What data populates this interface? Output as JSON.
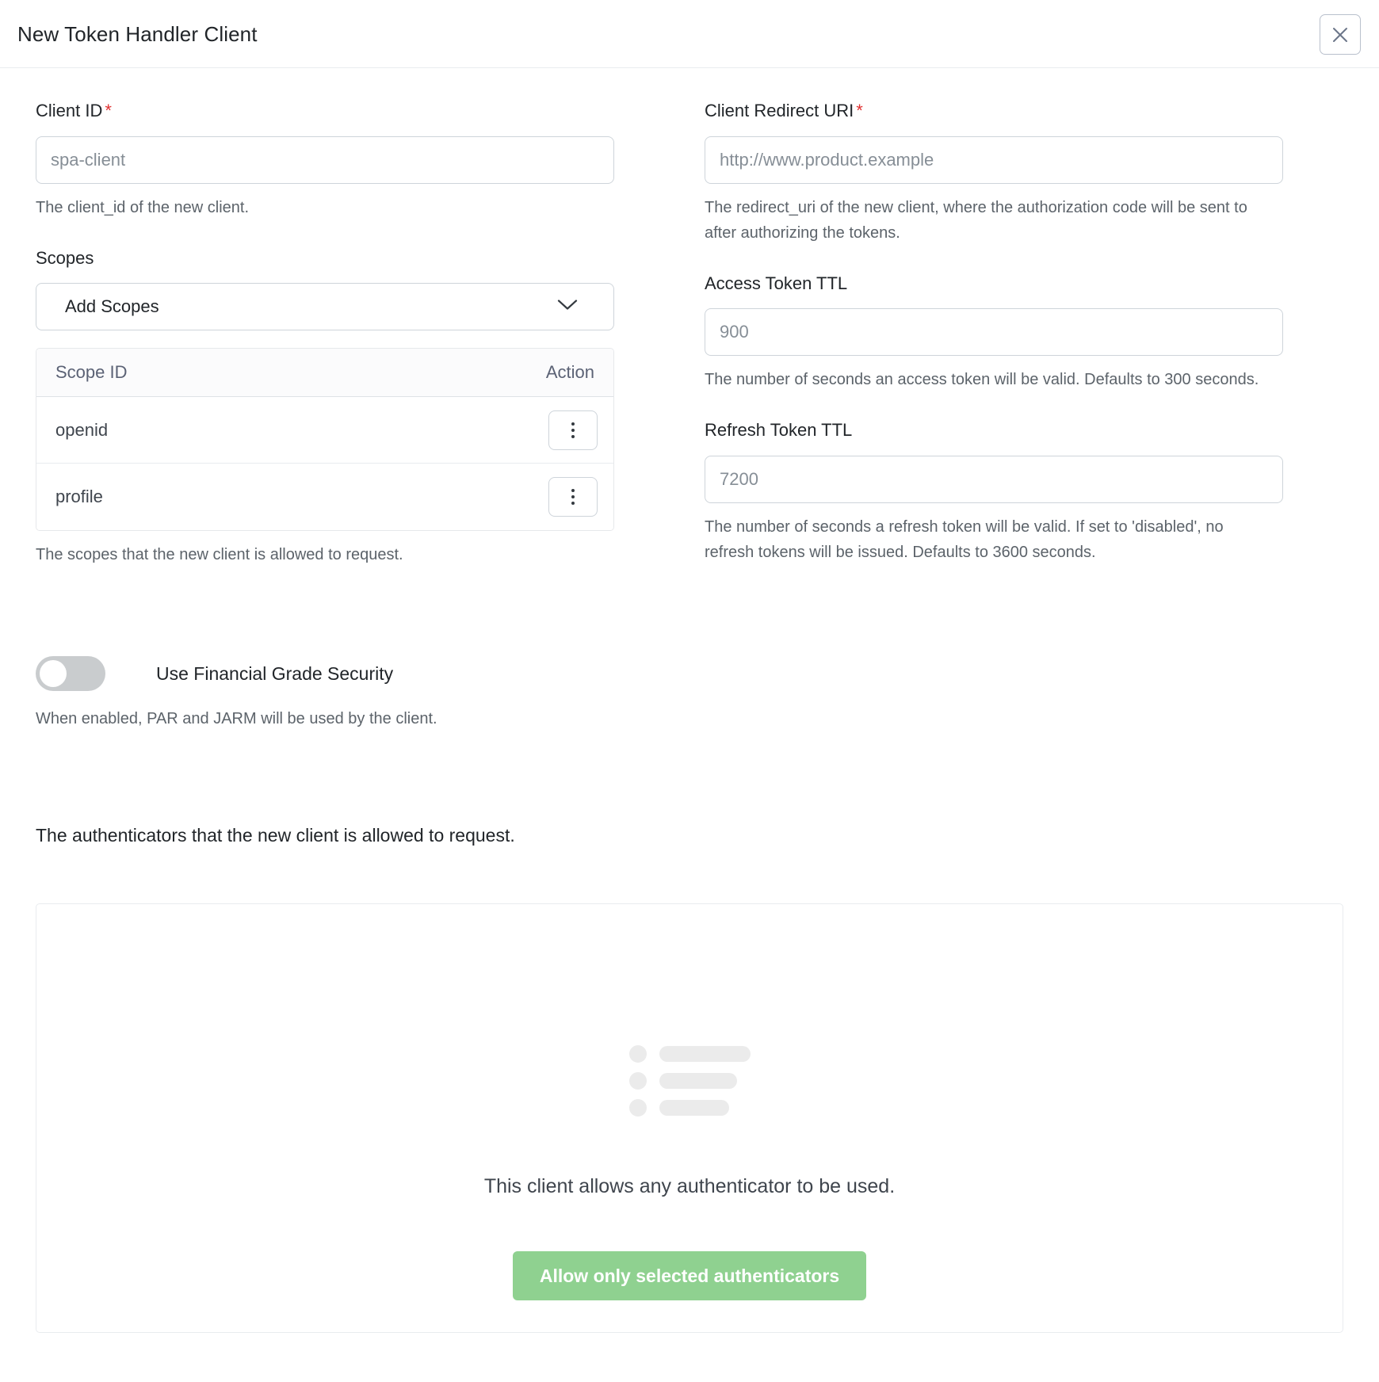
{
  "modal": {
    "title": "New Token Handler Client",
    "close_label": "close-icon"
  },
  "form": {
    "client_id": {
      "label": "Client ID",
      "required_marker": "*",
      "value": "spa-client",
      "placeholder": "spa-client",
      "help": "The client_id of the new client."
    },
    "scopes": {
      "label": "Scopes",
      "select_value": "Add Scopes",
      "columns": [
        "Scope ID",
        "Action"
      ],
      "rows": [
        {
          "scope_id": "openid",
          "action": "kebab-menu"
        },
        {
          "scope_id": "profile",
          "action": "kebab-menu"
        }
      ],
      "help": "The scopes that the new client is allowed to request."
    },
    "financial_grade_security": {
      "label": "Use Financial Grade Security",
      "state": "off",
      "help": "When enabled, PAR and JARM will be used by the client."
    },
    "client_redirect_uri": {
      "label": "Client Redirect URI",
      "required_marker": "*",
      "value": "http://www.product.example",
      "placeholder": "http://www.product.example",
      "help": "The redirect_uri of the new client, where the authorization code will be sent to after authorizing the tokens."
    },
    "access_token_ttl": {
      "label": "Access Token TTL",
      "value": "900",
      "placeholder": "900",
      "help": "The number of seconds an access token will be valid. Defaults to 300 seconds."
    },
    "refresh_token_ttl": {
      "label": "Refresh Token TTL",
      "value": "7200",
      "placeholder": "7200",
      "help": "The number of seconds a refresh token will be valid. If set to 'disabled', no refresh tokens will be issued. Defaults to 3600 seconds."
    }
  },
  "authenticators": {
    "intro": "The authenticators that the new client is allowed to request.",
    "empty_text": "This client allows any authenticator to be used.",
    "button_label": "Allow only selected authenticators"
  },
  "colors": {
    "accent_green": "#8fd190",
    "required_red": "#e03131",
    "border": "#ced4da",
    "muted_text": "#5c636a",
    "toggle_off": "#c9ccce",
    "skeleton": "#ebebeb"
  }
}
